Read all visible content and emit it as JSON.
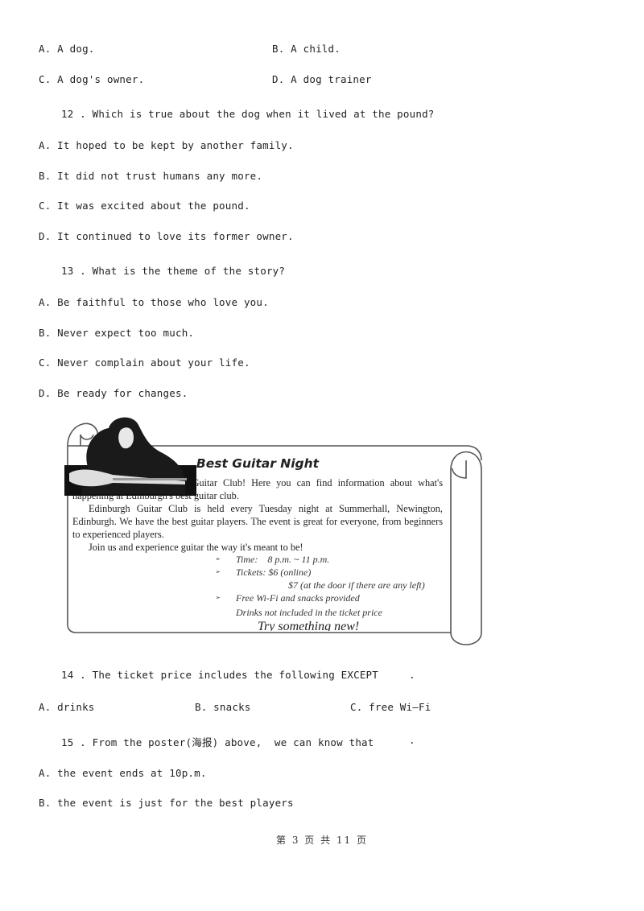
{
  "q11_options": {
    "A": "A. A dog.",
    "B": "B. A child.",
    "C": "C. A dog's owner.",
    "D": "D. A dog trainer"
  },
  "q12": {
    "question": "12 . Which is true about the dog when it lived at the pound?",
    "options": [
      "A. It hoped to be kept by another family.",
      "B. It did not trust humans any more.",
      "C. It was excited about the pound.",
      "D. It continued to love its former owner."
    ]
  },
  "q13": {
    "question": "13 . What is the theme of the story?",
    "options": [
      "A. Be faithful to those who love you.",
      "B. Never expect too much.",
      "C. Never complain about your life.",
      "D. Be ready for changes."
    ]
  },
  "poster": {
    "title": "Best Guitar Night",
    "para1": "Welcome to Edinburgh Guitar Club! Here you can find information about what's happening at Edinburgh's best guitar club.",
    "para2": "Edinburgh Guitar Club is held every Tuesday night at Summerhall, Newington, Edinburgh. We have the best guitar players. The event is great for everyone, from beginners to experienced players.",
    "para3": "Join us and experience guitar the way it's meant to be!",
    "bullets": [
      "Time:    8 p.m. ~ 11 p.m.",
      "Tickets: $6 (online)",
      "$7 (at the door if there are any left)",
      "Free Wi-Fi and snacks provided",
      "Drinks not included in the ticket price"
    ],
    "slogan": "Try something new!",
    "image_alt": "guitarist photo"
  },
  "q14": {
    "question": "14 . The ticket price includes the following EXCEPT",
    "blank": ".",
    "options": [
      "A. drinks",
      "B. snacks",
      "C. free Wi—Fi"
    ]
  },
  "q15": {
    "question": "15 . From the poster(海报) above,  we can know that",
    "blank": ".",
    "options": [
      "A. the event ends at 10p.m.",
      "B. the event is just for the best players"
    ]
  },
  "footer": {
    "page_label": "第 3 页 共 11 页"
  }
}
